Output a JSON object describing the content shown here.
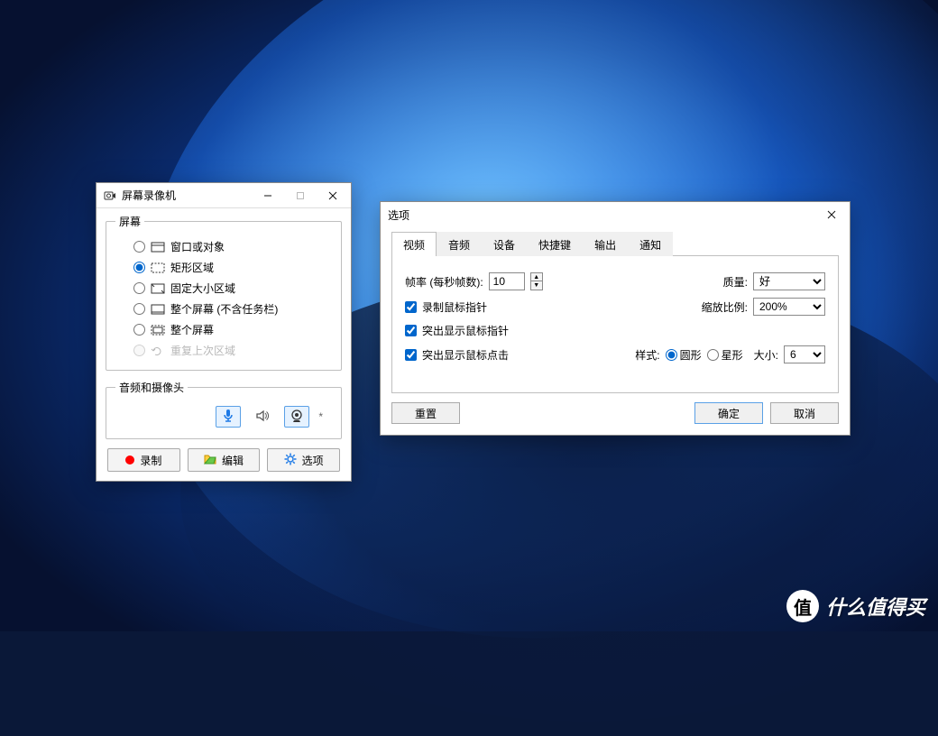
{
  "watermark": {
    "badge": "值",
    "text": "什么值得买"
  },
  "recorder": {
    "title": "屏幕录像机",
    "groups": {
      "screen": {
        "legend": "屏幕",
        "options": [
          {
            "label": "窗口或对象",
            "checked": false,
            "disabled": false,
            "icon": "window"
          },
          {
            "label": "矩形区域",
            "checked": true,
            "disabled": false,
            "icon": "rect-dashed"
          },
          {
            "label": "固定大小区域",
            "checked": false,
            "disabled": false,
            "icon": "fixed-size"
          },
          {
            "label": "整个屏幕 (不含任务栏)",
            "checked": false,
            "disabled": false,
            "icon": "screen-notaskbar"
          },
          {
            "label": "整个屏幕",
            "checked": false,
            "disabled": false,
            "icon": "screen-full"
          },
          {
            "label": "重复上次区域",
            "checked": false,
            "disabled": true,
            "icon": "repeat"
          }
        ]
      },
      "audio": {
        "legend": "音频和摄像头",
        "asterisk": "*"
      }
    },
    "buttons": {
      "record": "录制",
      "edit": "编辑",
      "options": "选项"
    }
  },
  "options": {
    "title": "选项",
    "tabs": [
      "视频",
      "音频",
      "设备",
      "快捷键",
      "输出",
      "通知"
    ],
    "active_tab": 0,
    "video": {
      "framerate_label": "帧率 (每秒帧数):",
      "framerate_value": "10",
      "quality_label": "质量:",
      "quality_value": "好",
      "check_record_pointer": "录制鼠标指针",
      "scale_label": "缩放比例:",
      "scale_value": "200%",
      "check_highlight_pointer": "突出显示鼠标指针",
      "check_highlight_click": "突出显示鼠标点击",
      "style_label": "样式:",
      "style_circle": "圆形",
      "style_star": "星形",
      "size_label": "大小:",
      "size_value": "6"
    },
    "buttons": {
      "reset": "重置",
      "ok": "确定",
      "cancel": "取消"
    }
  }
}
